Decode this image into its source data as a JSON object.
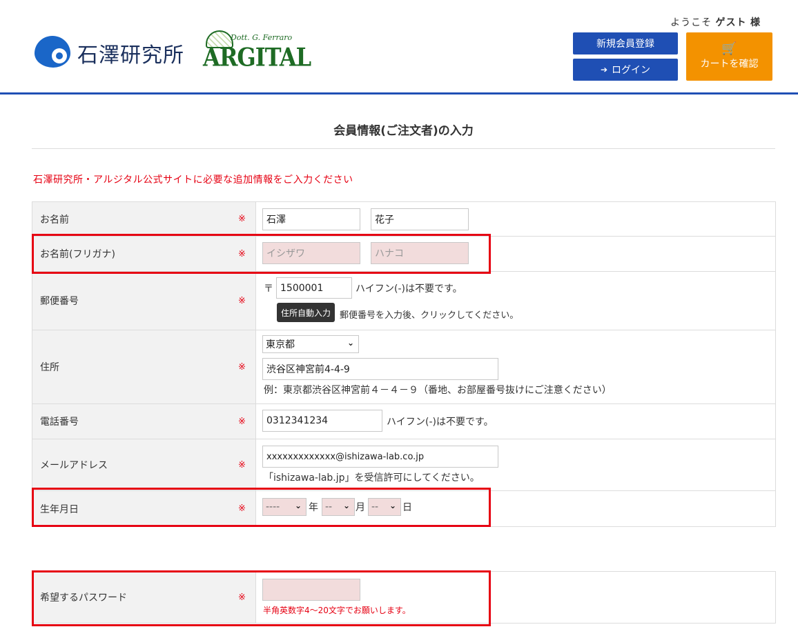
{
  "header": {
    "logo_text": "石澤研究所",
    "argital_sub": "Dott. G. Ferraro",
    "argital_main": "ARGITAL",
    "welcome_prefix": "ようこそ",
    "welcome_user": "ゲスト",
    "welcome_suffix": "様",
    "register_label": "新規会員登録",
    "login_label": "ログイン",
    "cart_label": "カートを確認"
  },
  "page": {
    "title": "会員情報(ご注文者)の入力",
    "notice": "石澤研究所・アルジタル公式サイトに必要な追加情報をご入力ください",
    "required_mark": "※"
  },
  "form": {
    "name": {
      "label": "お名前",
      "last": "石澤",
      "first": "花子"
    },
    "kana": {
      "label": "お名前(フリガナ)",
      "last_placeholder": "イシザワ",
      "first_placeholder": "ハナコ"
    },
    "postal": {
      "label": "郵便番号",
      "prefix": "〒",
      "value": "1500001",
      "hint": "ハイフン(-)は不要です。",
      "auto_button": "住所自動入力",
      "auto_hint": "郵便番号を入力後、クリックしてください。"
    },
    "address": {
      "label": "住所",
      "prefecture": "東京都",
      "value": "渋谷区神宮前4-4-9",
      "example": "例：東京都渋谷区神宮前４－４－９（番地、お部屋番号抜けにご注意ください）"
    },
    "phone": {
      "label": "電話番号",
      "value": "0312341234",
      "hint": "ハイフン(-)は不要です。"
    },
    "email": {
      "label": "メールアドレス",
      "value": "xxxxxxxxxxxxx@ishizawa-lab.co.jp",
      "hint": "「ishizawa-lab.jp」を受信許可にしてください。"
    },
    "birthday": {
      "label": "生年月日",
      "year": "----",
      "year_unit": "年",
      "month": "--",
      "month_unit": "月",
      "day": "--",
      "day_unit": "日"
    },
    "password": {
      "label": "希望するパスワード",
      "hint": "半角英数字4～20文字でお願いします。"
    }
  },
  "colors": {
    "brand_blue": "#1f4fb4",
    "cart_orange": "#f39200",
    "required_red": "#e60012",
    "highlight_red": "#e60012"
  },
  "icons": {
    "login": "sign-in-icon",
    "cart": "shopping-cart-icon",
    "select": "chevron-down-icon"
  }
}
